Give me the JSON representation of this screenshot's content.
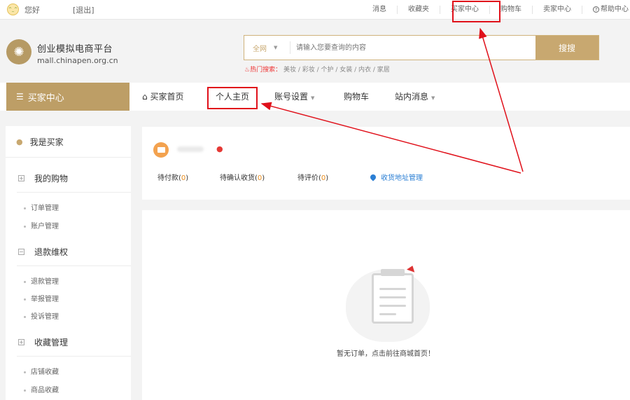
{
  "topbar": {
    "greeting": "您好",
    "logout": "[退出]",
    "nav": [
      "消息",
      "收藏夹",
      "买家中心",
      "购物车",
      "卖家中心",
      "帮助中心"
    ]
  },
  "header": {
    "logo_text": "创业模拟电商平台",
    "logo_url": "mall.chinapen.org.cn",
    "search_scope": "全网",
    "search_placeholder": "请输入您要查询的内容",
    "search_button": "搜搜",
    "hot_label": "热门搜索：",
    "hot_terms": "美妆 / 彩妆 / 个护 / 女装 / 内衣 / 家居"
  },
  "mainnav": {
    "buyer_center": "买家中心",
    "items": [
      "买家首页",
      "个人主页",
      "账号设置",
      "购物车",
      "站内消息"
    ]
  },
  "sidebar": {
    "title": "我是买家",
    "sections": [
      {
        "title": "我的购物",
        "links": [
          "订单管理",
          "账户管理"
        ]
      },
      {
        "title": "退款维权",
        "links": [
          "退款管理",
          "举报管理",
          "投诉管理"
        ]
      },
      {
        "title": "收藏管理",
        "links": [
          "店铺收藏",
          "商品收藏"
        ]
      }
    ]
  },
  "summary": {
    "stats": [
      {
        "label": "待付款",
        "count": "0"
      },
      {
        "label": "待确认收货",
        "count": "0"
      },
      {
        "label": "待评价",
        "count": "0"
      }
    ],
    "address": "收货地址管理"
  },
  "orders": {
    "empty_text": "暂无订单，点击前往商城首页！"
  },
  "colors": {
    "gold": "#bd9e66",
    "annotation_red": "#e0101a",
    "link_blue": "#2b7fd4"
  }
}
